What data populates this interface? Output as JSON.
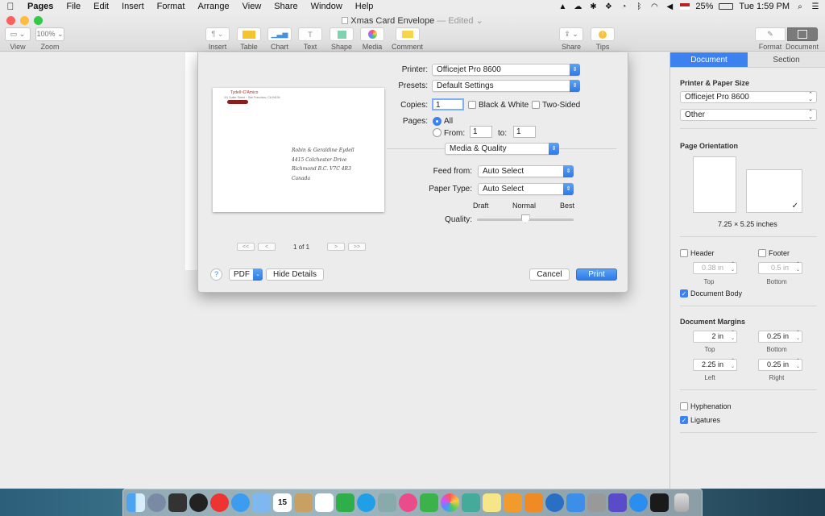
{
  "menubar": {
    "items": [
      "Pages",
      "File",
      "Edit",
      "Insert",
      "Format",
      "Arrange",
      "View",
      "Share",
      "Window",
      "Help"
    ],
    "battery": "25%",
    "clock": "Tue 1:59 PM"
  },
  "window": {
    "title": "Xmas Card Envelope",
    "edited": "— Edited ⌄",
    "toolbar": {
      "view": "View",
      "zoom": "Zoom",
      "zoom_value": "100% ⌄",
      "insert": "Insert",
      "table": "Table",
      "chart": "Chart",
      "text": "Text",
      "shape": "Shape",
      "media": "Media",
      "comment": "Comment",
      "share": "Share",
      "tips": "Tips",
      "format": "Format",
      "document": "Document"
    }
  },
  "print": {
    "printer_label": "Printer:",
    "printer": "Officejet Pro 8600",
    "presets_label": "Presets:",
    "presets": "Default Settings",
    "copies_label": "Copies:",
    "copies": "1",
    "bw": "Black & White",
    "two_sided": "Two-Sided",
    "pages_label": "Pages:",
    "all": "All",
    "from": "From:",
    "from_val": "1",
    "to": "to:",
    "to_val": "1",
    "section": "Media & Quality",
    "feed_label": "Feed from:",
    "feed": "Auto Select",
    "paper_label": "Paper Type:",
    "paper": "Auto Select",
    "draft": "Draft",
    "normal": "Normal",
    "best": "Best",
    "quality_label": "Quality:",
    "quality_level": 0.5,
    "page_of": "1 of 1",
    "help": "?",
    "pdf": "PDF",
    "hide": "Hide Details",
    "cancel": "Cancel",
    "print": "Print",
    "preview": {
      "return_name": "Tydell~D'Amico",
      "return_addr": "111 Sutter Street ~ San Francisco, CA 94104",
      "to_lines": [
        "Robin & Geraldine Eydell",
        "4415 Colchester Drive",
        "Richmond B.C. V7C 4R3",
        "Canada"
      ]
    }
  },
  "inspector": {
    "tab_document": "Document",
    "tab_section": "Section",
    "printer_paper": "Printer & Paper Size",
    "printer": "Officejet Pro 8600",
    "paper": "Other",
    "orientation": "Page Orientation",
    "size": "7.25 × 5.25 inches",
    "header": "Header",
    "footer": "Footer",
    "header_val": "0.38 in",
    "footer_val": "0.5 in",
    "top": "Top",
    "bottom": "Bottom",
    "doc_body": "Document Body",
    "margins": "Document Margins",
    "m_top": "2 in",
    "m_bottom": "0.25 in",
    "m_left": "2.25 in",
    "m_right": "0.25 in",
    "left": "Left",
    "right": "Right",
    "hyphenation": "Hyphenation",
    "ligatures": "Ligatures"
  },
  "dock": {
    "calendar_day": "15",
    "mail_badge": "1"
  }
}
